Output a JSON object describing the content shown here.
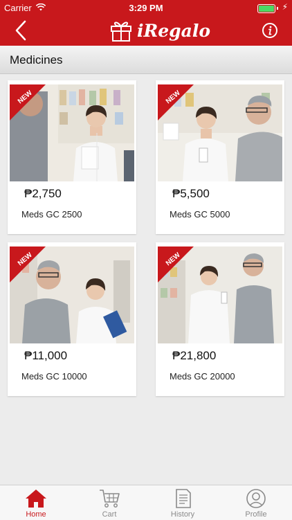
{
  "status_bar": {
    "carrier": "Carrier",
    "time": "3:29 PM"
  },
  "nav": {
    "app_name": "iRegalo",
    "back_icon": "chevron-left-icon",
    "info_icon": "info-icon"
  },
  "section": {
    "title": "Medicines"
  },
  "products": [
    {
      "price": "₱2,750",
      "name": "Meds GC 2500",
      "badge": "NEW"
    },
    {
      "price": "₱5,500",
      "name": "Meds GC 5000",
      "badge": "NEW"
    },
    {
      "price": "₱11,000",
      "name": "Meds GC 10000",
      "badge": "NEW"
    },
    {
      "price": "₱21,800",
      "name": "Meds GC 20000",
      "badge": "NEW"
    }
  ],
  "tabs": [
    {
      "label": "Home",
      "icon": "home-icon",
      "active": true
    },
    {
      "label": "Cart",
      "icon": "cart-icon",
      "active": false
    },
    {
      "label": "History",
      "icon": "history-icon",
      "active": false
    },
    {
      "label": "Profile",
      "icon": "profile-icon",
      "active": false
    }
  ],
  "colors": {
    "brand": "#c8181c",
    "tab_inactive": "#8a8a8a",
    "battery": "#4cd964"
  }
}
